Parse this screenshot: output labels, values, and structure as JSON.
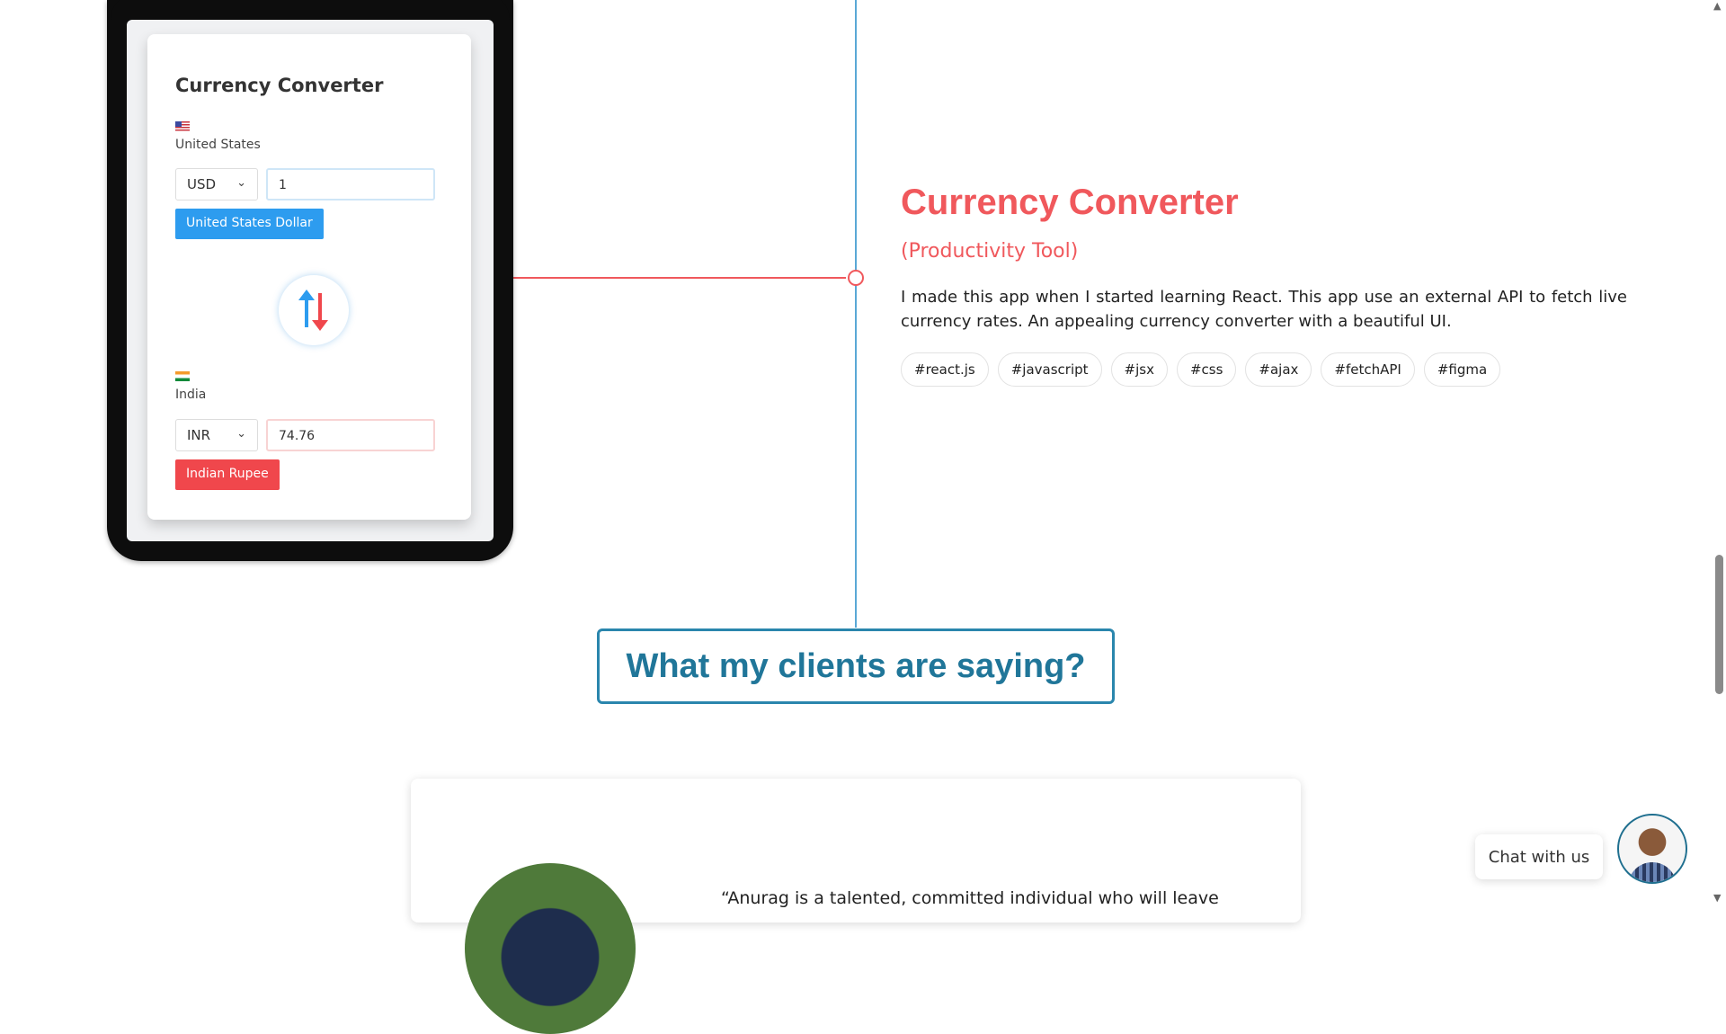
{
  "project": {
    "title": "Currency Converter",
    "category": "(Productivity Tool)",
    "description": "I made this app when I started learning React. This app use an external API to fetch live currency rates. An appealing currency converter with a beautiful UI.",
    "tags": [
      "#react.js",
      "#javascript",
      "#jsx",
      "#css",
      "#ajax",
      "#fetchAPI",
      "#figma"
    ]
  },
  "mockup": {
    "title": "Currency Converter",
    "from": {
      "country": "United States",
      "code": "USD",
      "amount": "1",
      "name": "United States Dollar"
    },
    "to": {
      "country": "India",
      "code": "INR",
      "amount": "74.76",
      "name": "Indian Rupee"
    }
  },
  "clients": {
    "heading": "What my clients are saying?"
  },
  "testimonial": {
    "quote": "“Anurag is a talented, committed individual who will leave"
  },
  "chat": {
    "label": "Chat with us"
  }
}
